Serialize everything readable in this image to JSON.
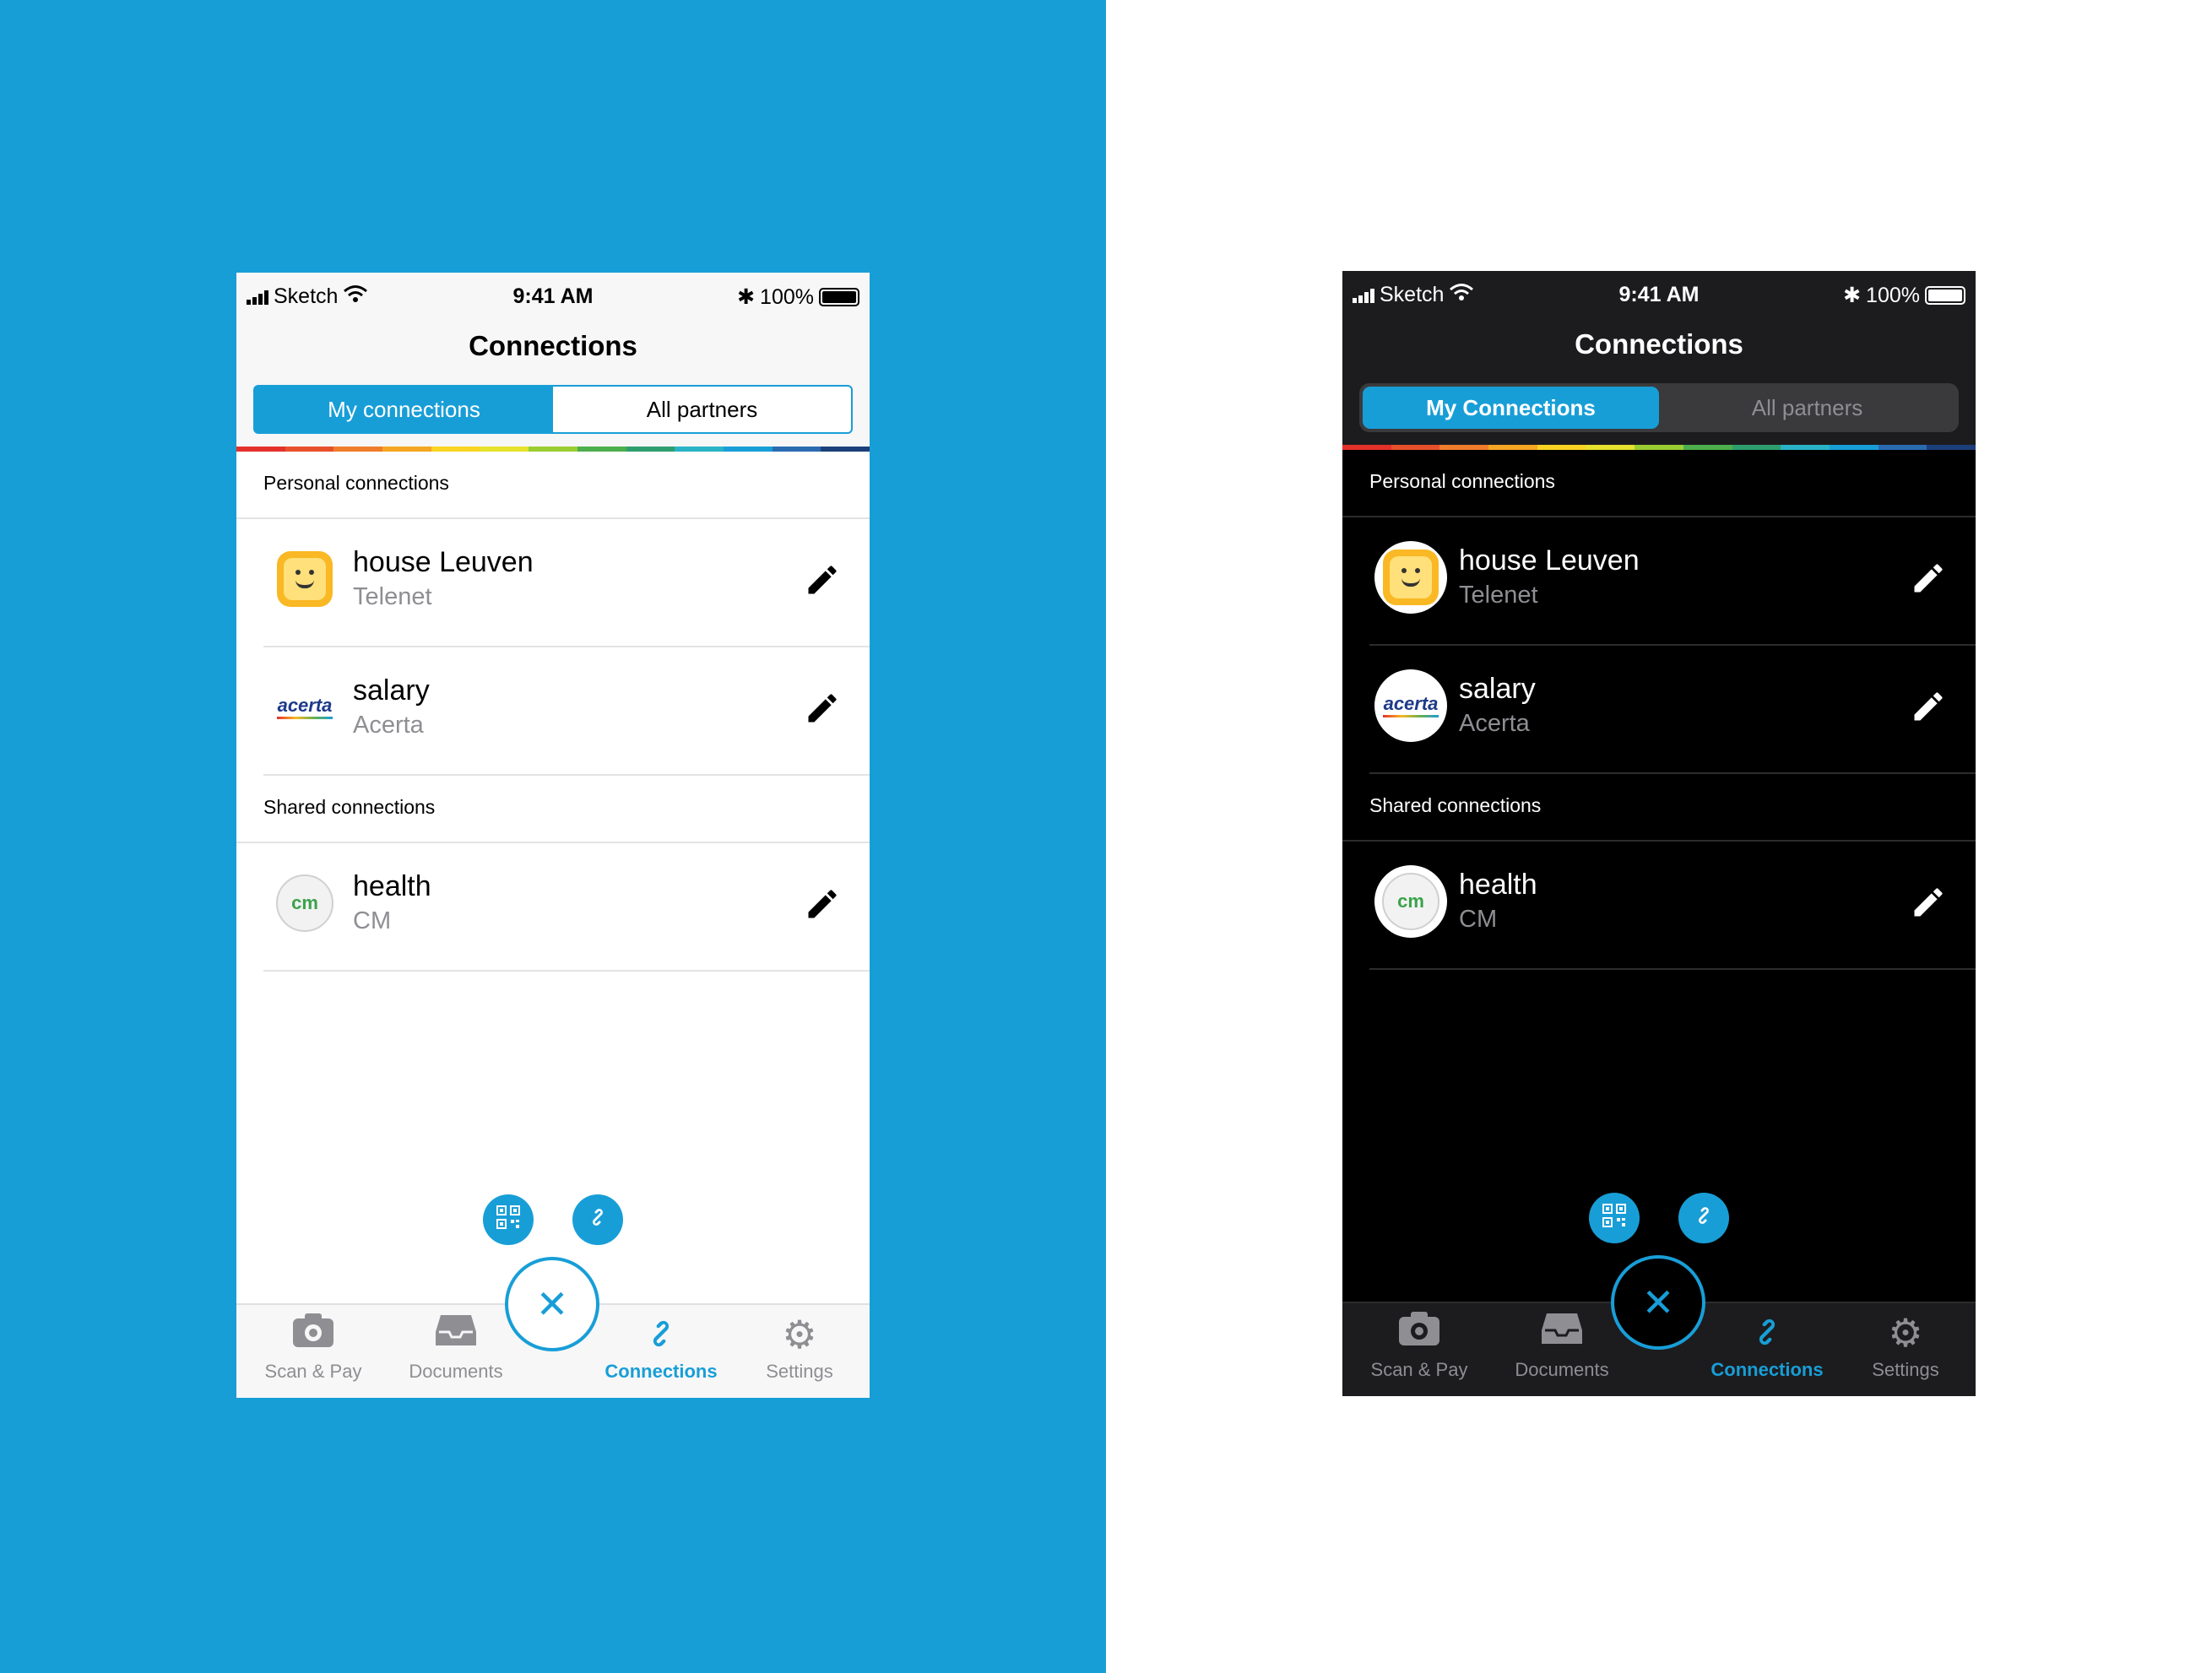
{
  "colors": {
    "accent": "#189ed7",
    "background_left": "#189ed7",
    "background_right": "#ffffff"
  },
  "rainbow": [
    "#e4312b",
    "#e8502c",
    "#f07d2c",
    "#f5a623",
    "#f9d423",
    "#e6e22d",
    "#9acd32",
    "#4cae4c",
    "#2e9e6e",
    "#2ab3c6",
    "#189ed7",
    "#2a6bb0",
    "#1b3f7a"
  ],
  "light": {
    "status": {
      "carrier": "Sketch",
      "time": "9:41 AM",
      "battery": "100%"
    },
    "title": "Connections",
    "tabs": {
      "mine": "My connections",
      "all": "All partners"
    },
    "personal_label": "Personal connections",
    "shared_label": "Shared connections",
    "connections": [
      {
        "name": "house Leuven",
        "provider": "Telenet",
        "icon": "telenet-logo"
      },
      {
        "name": "salary",
        "provider": "Acerta",
        "icon": "acerta-logo"
      },
      {
        "name": "health",
        "provider": "CM",
        "icon": "cm-logo"
      }
    ],
    "nav": [
      {
        "label": "Scan & Pay",
        "icon": "camera-icon"
      },
      {
        "label": "Documents",
        "icon": "inbox-icon"
      },
      {
        "label": "Connections",
        "icon": "link-icon",
        "active": true
      },
      {
        "label": "Settings",
        "icon": "gear-icon"
      }
    ]
  },
  "dark": {
    "status": {
      "carrier": "Sketch",
      "time": "9:41 AM",
      "battery": "100%"
    },
    "title": "Connections",
    "tabs": {
      "mine": "My Connections",
      "all": "All partners"
    },
    "personal_label": "Personal connections",
    "shared_label": "Shared connections",
    "connections": [
      {
        "name": "house Leuven",
        "provider": "Telenet",
        "icon": "telenet-logo"
      },
      {
        "name": "salary",
        "provider": "Acerta",
        "icon": "acerta-logo"
      },
      {
        "name": "health",
        "provider": "CM",
        "icon": "cm-logo"
      }
    ],
    "nav": [
      {
        "label": "Scan & Pay",
        "icon": "camera-icon"
      },
      {
        "label": "Documents",
        "icon": "inbox-icon"
      },
      {
        "label": "Connections",
        "icon": "link-icon",
        "active": true
      },
      {
        "label": "Settings",
        "icon": "gear-icon"
      }
    ]
  },
  "logos": {
    "acerta": "acerta",
    "cm": "cm"
  }
}
